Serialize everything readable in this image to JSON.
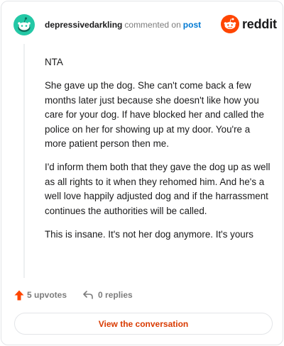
{
  "header": {
    "username": "depressivedarkling",
    "action_text": "commented on",
    "post_link": "post",
    "logo_text": "reddit"
  },
  "comment": {
    "paragraphs": [
      "NTA",
      "She gave up the dog. She can't come back a few months later just because she doesn't like how you care for your dog. If have blocked her and called the police on her for showing up at my door. You're a more patient person then me.",
      "I'd inform them both that they gave the dog up as well as all rights to it when they rehomed him. And he's a well love happily adjusted dog and if the harrassment continues the authorities will be called.",
      "This is insane. It's not her dog anymore. It's yours"
    ]
  },
  "footer": {
    "upvotes": "5 upvotes",
    "replies": "0 replies"
  },
  "view_button": "View the conversation",
  "colors": {
    "avatar": "#24c8a6",
    "brand": "#ff4500",
    "link": "#0079d3",
    "button_text": "#d93a00"
  }
}
